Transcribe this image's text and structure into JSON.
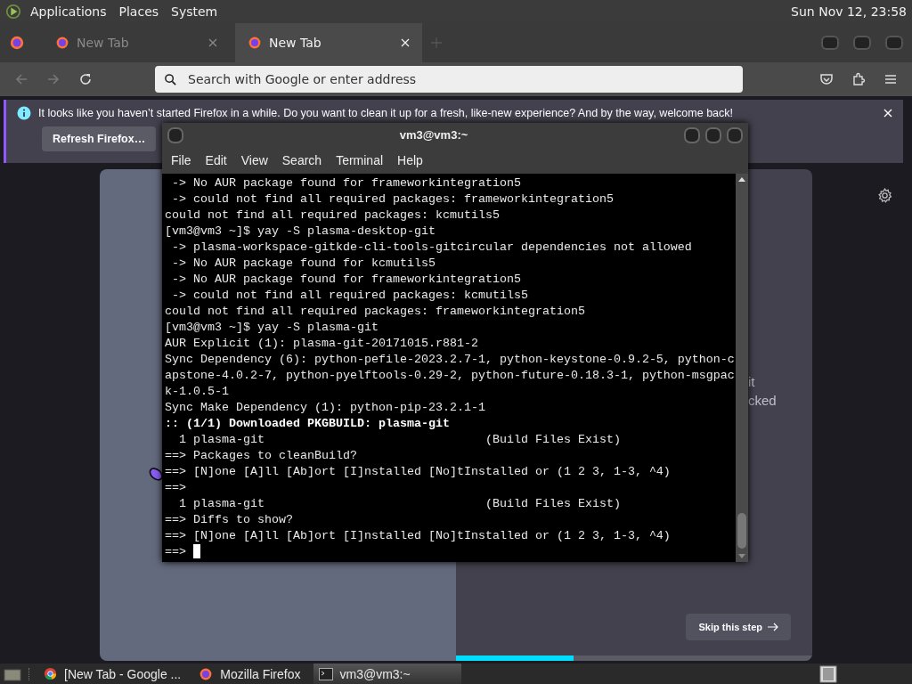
{
  "top_panel": {
    "menus": [
      "Applications",
      "Places",
      "System"
    ],
    "clock": "Sun Nov 12, 23:58"
  },
  "browser": {
    "tabs": [
      {
        "label": "New Tab",
        "selected": false
      },
      {
        "label": "New Tab",
        "selected": true
      }
    ],
    "address": {
      "placeholder": "Search with Google or enter address"
    },
    "notification": {
      "message": "It looks like you haven’t started Firefox in a while. Do you want to clean it up for a fresh, like-new experience? And by the way, welcome back!",
      "button": "Refresh Firefox…"
    },
    "content": {
      "fragments": [
        "it",
        "cked"
      ],
      "skip_button": "Skip this step",
      "progress": {
        "level": 0.33
      }
    }
  },
  "terminal": {
    "title": "vm3@vm3:~",
    "menus": [
      "File",
      "Edit",
      "View",
      "Search",
      "Terminal",
      "Help"
    ],
    "cursor": true,
    "lines": [
      {
        "text": " -> No AUR package found for frameworkintegration5",
        "kind": "normal"
      },
      {
        "text": " -> could not find all required packages: frameworkintegration5",
        "kind": "normal"
      },
      {
        "text": "could not find all required packages: kcmutils5",
        "kind": "normal"
      },
      {
        "text": "[vm3@vm3 ~]$ yay -S plasma-desktop-git",
        "kind": "normal"
      },
      {
        "text": " -> plasma-workspace-gitkde-cli-tools-gitcircular dependencies not allowed",
        "kind": "normal"
      },
      {
        "text": " -> No AUR package found for kcmutils5",
        "kind": "normal"
      },
      {
        "text": " -> No AUR package found for frameworkintegration5",
        "kind": "normal"
      },
      {
        "text": " -> could not find all required packages: kcmutils5",
        "kind": "normal"
      },
      {
        "text": "could not find all required packages: frameworkintegration5",
        "kind": "normal"
      },
      {
        "text": "[vm3@vm3 ~]$ yay -S plasma-git",
        "kind": "normal"
      },
      {
        "text": "AUR Explicit (1): plasma-git-20171015.r881-2",
        "kind": "normal"
      },
      {
        "text": "Sync Dependency (6): python-pefile-2023.2.7-1, python-keystone-0.9.2-5, python-c",
        "kind": "normal"
      },
      {
        "text": "apstone-4.0.2-7, python-pyelftools-0.29-2, python-future-0.18.3-1, python-msgpac",
        "kind": "normal"
      },
      {
        "text": "k-1.0.5-1",
        "kind": "normal"
      },
      {
        "text": "Sync Make Dependency (1): python-pip-23.2.1-1",
        "kind": "normal"
      },
      {
        "text": ":: (1/1) Downloaded PKGBUILD: plasma-git",
        "kind": "bold"
      },
      {
        "text": "  1 plasma-git                               (Build Files Exist)",
        "kind": "normal"
      },
      {
        "text": "==> Packages to cleanBuild?",
        "kind": "normal"
      },
      {
        "text": "==> [N]one [A]ll [Ab]ort [I]nstalled [No]tInstalled or (1 2 3, 1-3, ^4)",
        "kind": "normal"
      },
      {
        "text": "==>",
        "kind": "normal"
      },
      {
        "text": "  1 plasma-git                               (Build Files Exist)",
        "kind": "normal"
      },
      {
        "text": "==> Diffs to show?",
        "kind": "normal"
      },
      {
        "text": "==> [N]one [A]ll [Ab]ort [I]nstalled [No]tInstalled or (1 2 3, 1-3, ^4)",
        "kind": "normal"
      },
      {
        "text": "==> ",
        "kind": "prompt"
      }
    ]
  },
  "taskbar": {
    "items": [
      {
        "label": "[New Tab - Google ...",
        "kind": "chrome",
        "selected": false
      },
      {
        "label": "Mozilla Firefox",
        "kind": "firefox",
        "selected": false
      },
      {
        "label": "vm3@vm3:~",
        "kind": "terminal",
        "selected": true
      }
    ]
  }
}
